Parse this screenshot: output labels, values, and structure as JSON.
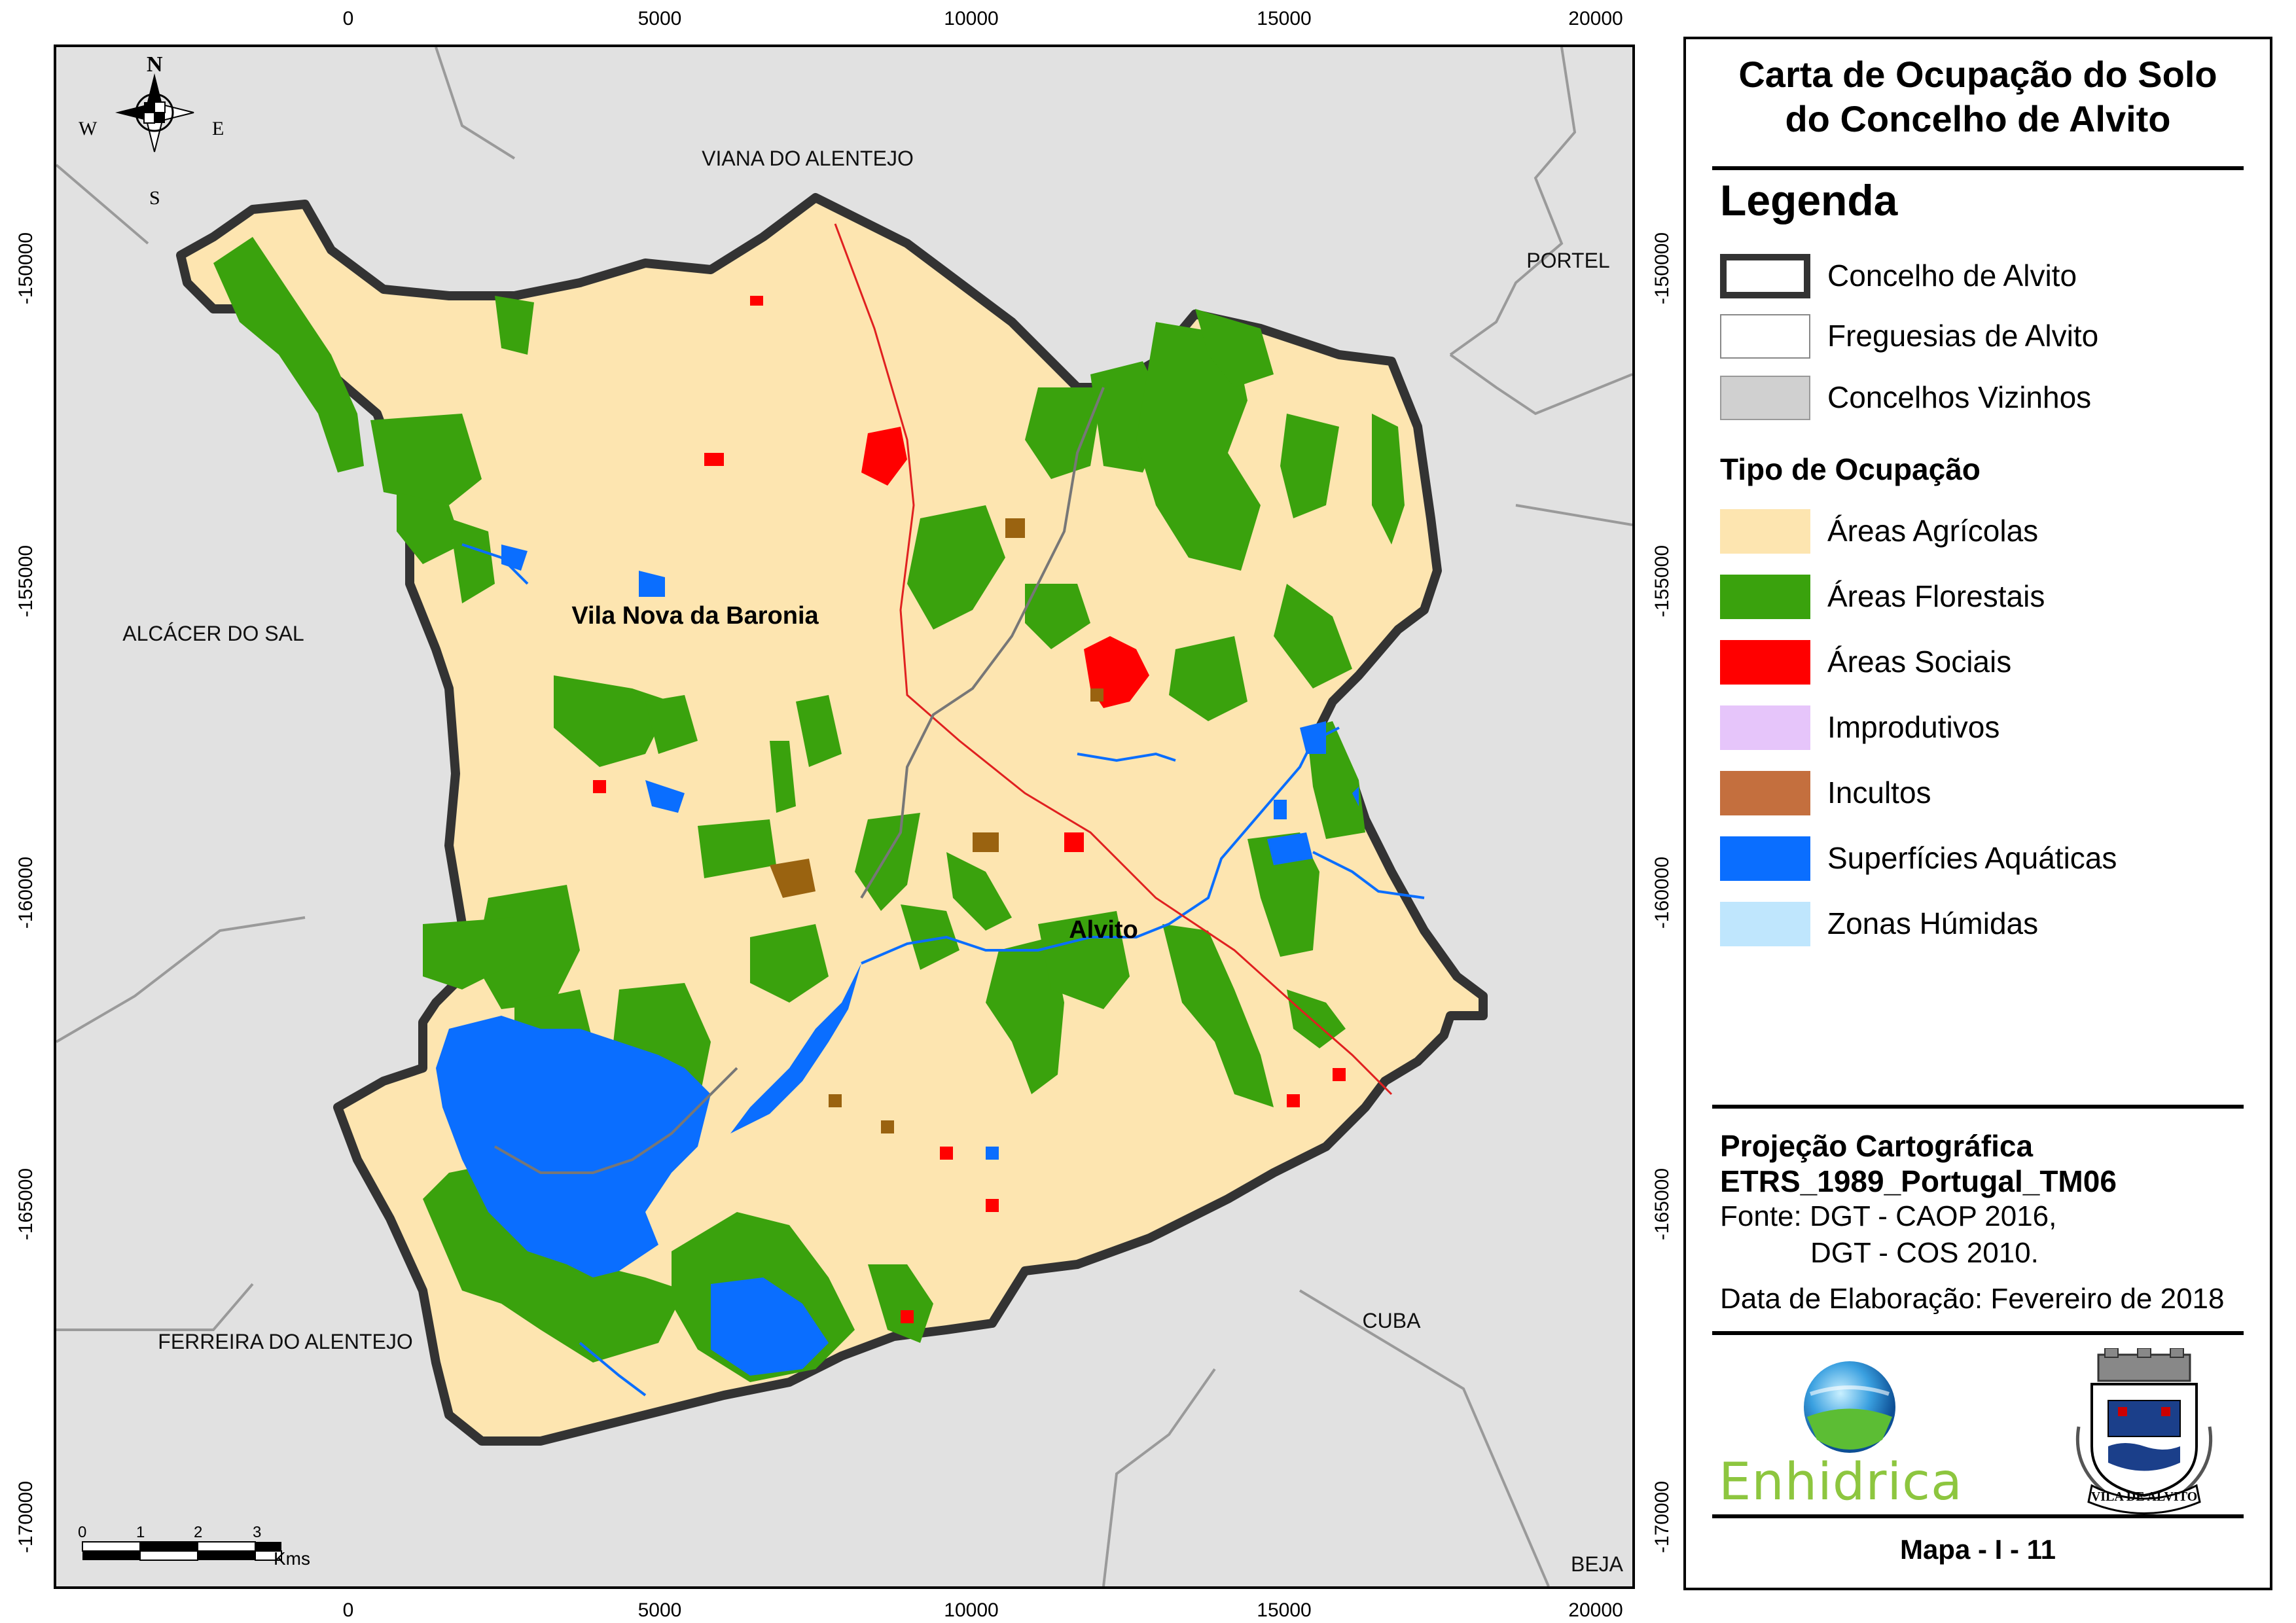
{
  "map": {
    "x_ticks": [
      "0",
      "5000",
      "10000",
      "15000",
      "20000"
    ],
    "y_ticks": [
      "-150000",
      "-155000",
      "-160000",
      "-165000",
      "-170000"
    ],
    "neighbors": [
      "VIANA DO ALENTEJO",
      "PORTEL",
      "ALCÁCER DO SAL",
      "FERREIRA DO ALENTEJO",
      "CUBA",
      "BEJA"
    ],
    "parishes": [
      "Vila Nova da Baronia",
      "Alvito"
    ],
    "compass": {
      "n": "N",
      "s": "S",
      "e": "E",
      "w": "W"
    },
    "scalebar": {
      "labels": [
        "0",
        "1",
        "2",
        "3"
      ],
      "unit": "Kms"
    }
  },
  "panel": {
    "title_line1": "Carta de Ocupação do Solo",
    "title_line2": "do Concelho de Alvito",
    "legend_title": "Legenda",
    "boundary_items": [
      {
        "label": "Concelho de Alvito"
      },
      {
        "label": "Freguesias de Alvito"
      },
      {
        "label": "Concelhos Vizinhos"
      }
    ],
    "occupation_title": "Tipo de Ocupação",
    "occupation_items": [
      {
        "label": "Áreas Agrícolas",
        "color": "#fde5b0"
      },
      {
        "label": "Áreas Florestais",
        "color": "#3aa20d"
      },
      {
        "label": "Áreas Sociais",
        "color": "#ff0000"
      },
      {
        "label": "Improdutivos",
        "color": "#e6c5fa"
      },
      {
        "label": "Incultos",
        "color": "#c46f3e"
      },
      {
        "label": "Superfícies Aquáticas",
        "color": "#0a6eff"
      },
      {
        "label": "Zonas Húmidas",
        "color": "#bfe6fd"
      }
    ],
    "projection_title": "Projeção Cartográfica",
    "projection_name": "ETRS_1989_Portugal_TM06",
    "source_line1": "Fonte: DGT - CAOP 2016,",
    "source_line2": "DGT - COS 2010.",
    "date": "Data de Elaboração: Fevereiro de 2018",
    "logo_text": "Enhidrica",
    "crest_text": "VILA DE ALVITO",
    "map_number": "Mapa - I - 11"
  }
}
